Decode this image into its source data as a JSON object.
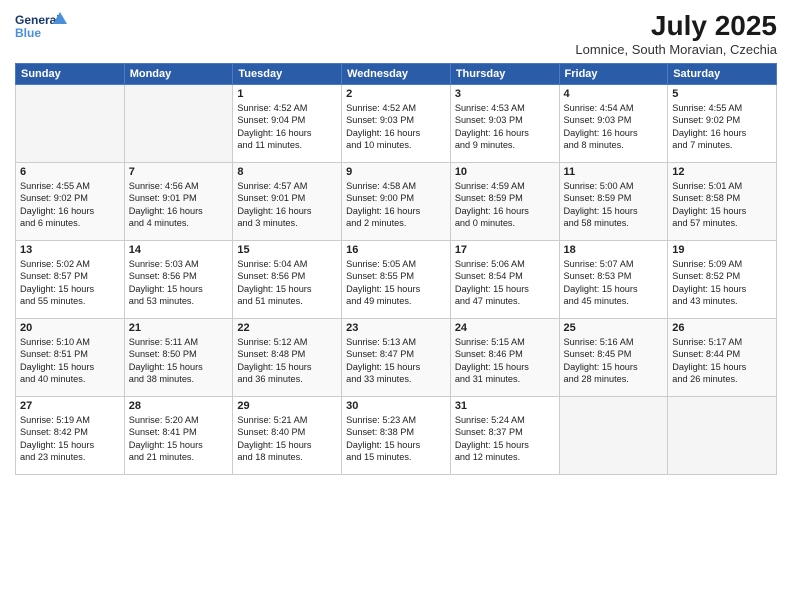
{
  "logo": {
    "line1": "General",
    "line2": "Blue"
  },
  "title": "July 2025",
  "subtitle": "Lomnice, South Moravian, Czechia",
  "header_days": [
    "Sunday",
    "Monday",
    "Tuesday",
    "Wednesday",
    "Thursday",
    "Friday",
    "Saturday"
  ],
  "weeks": [
    [
      {
        "day": "",
        "text": ""
      },
      {
        "day": "",
        "text": ""
      },
      {
        "day": "1",
        "text": "Sunrise: 4:52 AM\nSunset: 9:04 PM\nDaylight: 16 hours\nand 11 minutes."
      },
      {
        "day": "2",
        "text": "Sunrise: 4:52 AM\nSunset: 9:03 PM\nDaylight: 16 hours\nand 10 minutes."
      },
      {
        "day": "3",
        "text": "Sunrise: 4:53 AM\nSunset: 9:03 PM\nDaylight: 16 hours\nand 9 minutes."
      },
      {
        "day": "4",
        "text": "Sunrise: 4:54 AM\nSunset: 9:03 PM\nDaylight: 16 hours\nand 8 minutes."
      },
      {
        "day": "5",
        "text": "Sunrise: 4:55 AM\nSunset: 9:02 PM\nDaylight: 16 hours\nand 7 minutes."
      }
    ],
    [
      {
        "day": "6",
        "text": "Sunrise: 4:55 AM\nSunset: 9:02 PM\nDaylight: 16 hours\nand 6 minutes."
      },
      {
        "day": "7",
        "text": "Sunrise: 4:56 AM\nSunset: 9:01 PM\nDaylight: 16 hours\nand 4 minutes."
      },
      {
        "day": "8",
        "text": "Sunrise: 4:57 AM\nSunset: 9:01 PM\nDaylight: 16 hours\nand 3 minutes."
      },
      {
        "day": "9",
        "text": "Sunrise: 4:58 AM\nSunset: 9:00 PM\nDaylight: 16 hours\nand 2 minutes."
      },
      {
        "day": "10",
        "text": "Sunrise: 4:59 AM\nSunset: 8:59 PM\nDaylight: 16 hours\nand 0 minutes."
      },
      {
        "day": "11",
        "text": "Sunrise: 5:00 AM\nSunset: 8:59 PM\nDaylight: 15 hours\nand 58 minutes."
      },
      {
        "day": "12",
        "text": "Sunrise: 5:01 AM\nSunset: 8:58 PM\nDaylight: 15 hours\nand 57 minutes."
      }
    ],
    [
      {
        "day": "13",
        "text": "Sunrise: 5:02 AM\nSunset: 8:57 PM\nDaylight: 15 hours\nand 55 minutes."
      },
      {
        "day": "14",
        "text": "Sunrise: 5:03 AM\nSunset: 8:56 PM\nDaylight: 15 hours\nand 53 minutes."
      },
      {
        "day": "15",
        "text": "Sunrise: 5:04 AM\nSunset: 8:56 PM\nDaylight: 15 hours\nand 51 minutes."
      },
      {
        "day": "16",
        "text": "Sunrise: 5:05 AM\nSunset: 8:55 PM\nDaylight: 15 hours\nand 49 minutes."
      },
      {
        "day": "17",
        "text": "Sunrise: 5:06 AM\nSunset: 8:54 PM\nDaylight: 15 hours\nand 47 minutes."
      },
      {
        "day": "18",
        "text": "Sunrise: 5:07 AM\nSunset: 8:53 PM\nDaylight: 15 hours\nand 45 minutes."
      },
      {
        "day": "19",
        "text": "Sunrise: 5:09 AM\nSunset: 8:52 PM\nDaylight: 15 hours\nand 43 minutes."
      }
    ],
    [
      {
        "day": "20",
        "text": "Sunrise: 5:10 AM\nSunset: 8:51 PM\nDaylight: 15 hours\nand 40 minutes."
      },
      {
        "day": "21",
        "text": "Sunrise: 5:11 AM\nSunset: 8:50 PM\nDaylight: 15 hours\nand 38 minutes."
      },
      {
        "day": "22",
        "text": "Sunrise: 5:12 AM\nSunset: 8:48 PM\nDaylight: 15 hours\nand 36 minutes."
      },
      {
        "day": "23",
        "text": "Sunrise: 5:13 AM\nSunset: 8:47 PM\nDaylight: 15 hours\nand 33 minutes."
      },
      {
        "day": "24",
        "text": "Sunrise: 5:15 AM\nSunset: 8:46 PM\nDaylight: 15 hours\nand 31 minutes."
      },
      {
        "day": "25",
        "text": "Sunrise: 5:16 AM\nSunset: 8:45 PM\nDaylight: 15 hours\nand 28 minutes."
      },
      {
        "day": "26",
        "text": "Sunrise: 5:17 AM\nSunset: 8:44 PM\nDaylight: 15 hours\nand 26 minutes."
      }
    ],
    [
      {
        "day": "27",
        "text": "Sunrise: 5:19 AM\nSunset: 8:42 PM\nDaylight: 15 hours\nand 23 minutes."
      },
      {
        "day": "28",
        "text": "Sunrise: 5:20 AM\nSunset: 8:41 PM\nDaylight: 15 hours\nand 21 minutes."
      },
      {
        "day": "29",
        "text": "Sunrise: 5:21 AM\nSunset: 8:40 PM\nDaylight: 15 hours\nand 18 minutes."
      },
      {
        "day": "30",
        "text": "Sunrise: 5:23 AM\nSunset: 8:38 PM\nDaylight: 15 hours\nand 15 minutes."
      },
      {
        "day": "31",
        "text": "Sunrise: 5:24 AM\nSunset: 8:37 PM\nDaylight: 15 hours\nand 12 minutes."
      },
      {
        "day": "",
        "text": ""
      },
      {
        "day": "",
        "text": ""
      }
    ]
  ]
}
